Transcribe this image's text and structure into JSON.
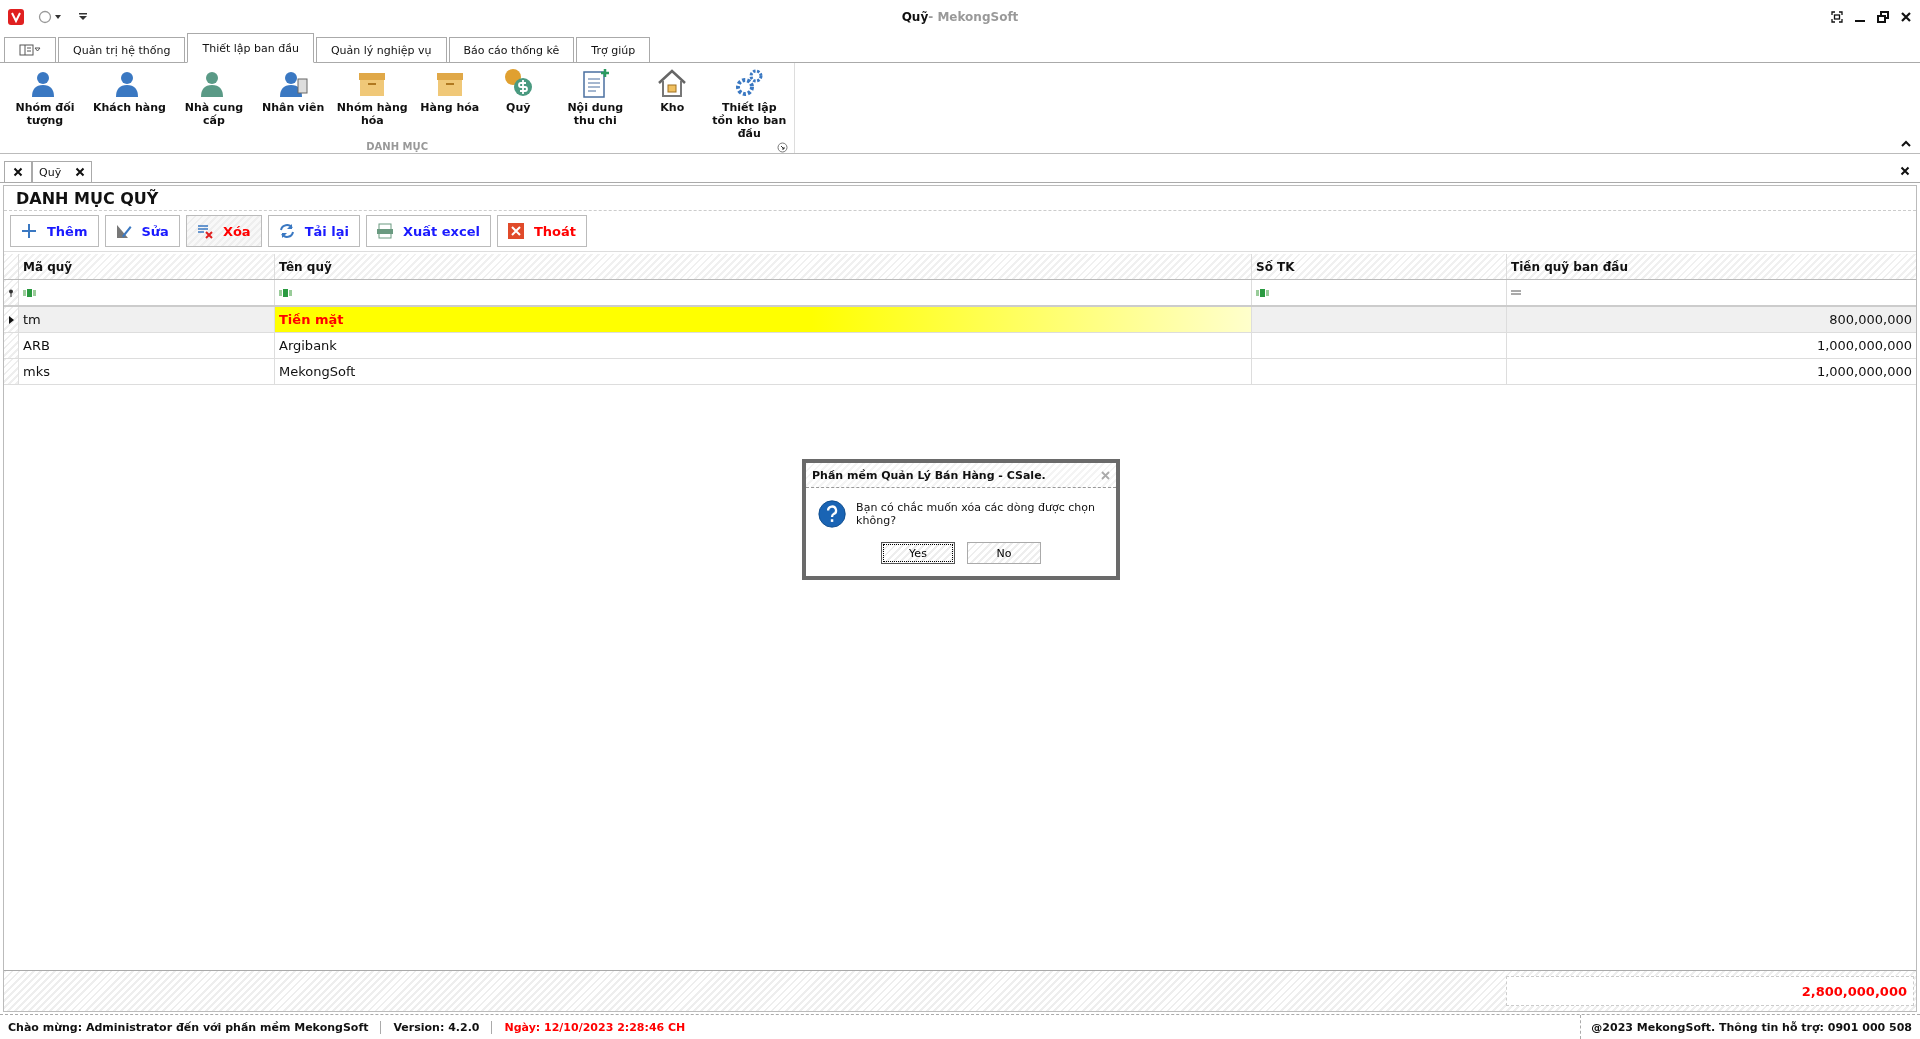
{
  "window": {
    "title_document": "Quỹ",
    "title_app": "- MekongSoft"
  },
  "ribbon_tabs": [
    {
      "label": "Quản trị hệ thống",
      "selected": false
    },
    {
      "label": "Thiết lập ban đầu",
      "selected": true
    },
    {
      "label": "Quản lý nghiệp vụ",
      "selected": false
    },
    {
      "label": "Báo cáo thống kê",
      "selected": false
    },
    {
      "label": "Trợ giúp",
      "selected": false
    }
  ],
  "ribbon_group": {
    "label": "DANH MỤC",
    "items": [
      {
        "label": "Nhóm đối tượng"
      },
      {
        "label": "Khách hàng"
      },
      {
        "label": "Nhà cung cấp"
      },
      {
        "label": "Nhân viên"
      },
      {
        "label": "Nhóm hàng hóa"
      },
      {
        "label": "Hàng hóa"
      },
      {
        "label": "Quỹ"
      },
      {
        "label": "Nội dung thu chi"
      },
      {
        "label": "Kho"
      },
      {
        "label": "Thiết lập tồn kho ban đầu"
      }
    ]
  },
  "document_tabs": [
    {
      "label": "Quỹ",
      "selected": true
    }
  ],
  "panel_title": "DANH MỤC QUỸ",
  "toolbar": [
    {
      "label": "Thêm",
      "color": "#1a1aff",
      "pressed": false
    },
    {
      "label": "Sửa",
      "color": "#1a1aff",
      "pressed": false
    },
    {
      "label": "Xóa",
      "color": "#ff0000",
      "pressed": true
    },
    {
      "label": "Tải lại",
      "color": "#1a1aff",
      "pressed": false
    },
    {
      "label": "Xuất excel",
      "color": "#1a1aff",
      "pressed": false
    },
    {
      "label": "Thoát",
      "color": "#ff0000",
      "pressed": false
    }
  ],
  "table": {
    "columns": [
      "Mã quỹ",
      "Tên quỹ",
      "Số TK",
      "Tiền quỹ ban đầu"
    ],
    "rows": [
      {
        "cells": [
          "tm",
          "Tiền mặt",
          "",
          "800,000,000"
        ],
        "selected": true
      },
      {
        "cells": [
          "ARB",
          "Argibank",
          "",
          "1,000,000,000"
        ],
        "selected": false
      },
      {
        "cells": [
          "mks",
          "MekongSoft",
          "",
          "1,000,000,000"
        ],
        "selected": false
      }
    ],
    "total": "2,800,000,000"
  },
  "dialog": {
    "title": "Phần mềm Quản Lý Bán Hàng - CSale.",
    "message": "Bạn có chắc muốn xóa các dòng được chọn không?",
    "buttons": [
      {
        "label": "Yes",
        "selected": true
      },
      {
        "label": "No",
        "selected": false
      }
    ]
  },
  "status_bar": {
    "welcome": "Chào mừng: Administrator đến với phần mềm MekongSoft",
    "version": "Version: 4.2.0",
    "date": "Ngày: 12/10/2023 2:28:46 CH",
    "support": "@2023 MekongSoft. Thông tin hỗ trợ: 0901 000 508"
  }
}
